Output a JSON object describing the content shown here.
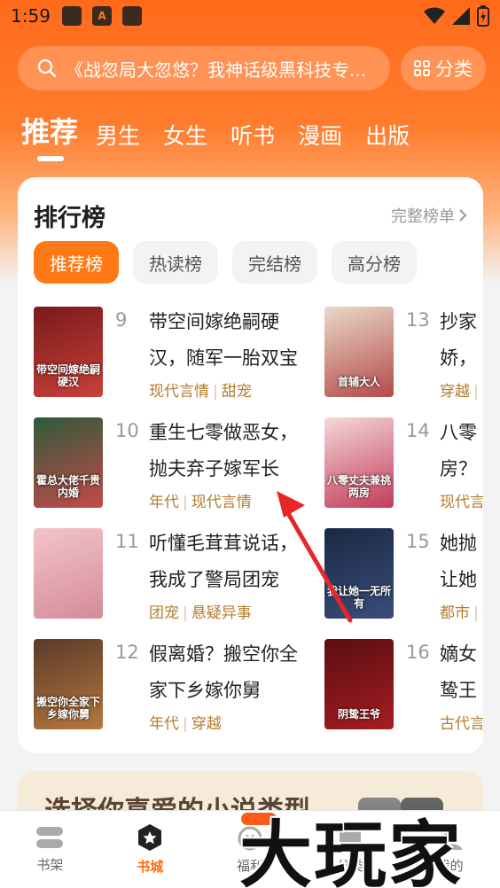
{
  "status": {
    "time": "1:59",
    "app_icon_letter": "A"
  },
  "search": {
    "placeholder": "《战忽局大忽悠？我神话级黑科技专...",
    "category_label": "分类"
  },
  "top_tabs": [
    "推荐",
    "男生",
    "女生",
    "听书",
    "漫画",
    "出版"
  ],
  "ranking": {
    "title": "排行榜",
    "more": "完整榜单",
    "chips": [
      "推荐榜",
      "热读榜",
      "完结榜",
      "高分榜"
    ],
    "books_left": [
      {
        "rank": "9",
        "title": "带空间嫁绝嗣硬汉，随军一胎双宝",
        "tags": [
          "现代言情",
          "甜宠"
        ],
        "cover_text": "带空间嫁绝嗣硬汉",
        "cover_colors": [
          "#7a1a1a",
          "#c9403a"
        ]
      },
      {
        "rank": "10",
        "title": "重生七零做恶女，抛夫弃子嫁军长",
        "tags": [
          "年代",
          "现代言情"
        ],
        "cover_text": "霍总大佬千贵内婚",
        "cover_colors": [
          "#2f5a3a",
          "#c44a4a"
        ]
      },
      {
        "rank": "11",
        "title": "听懂毛茸茸说话，我成了警局团宠",
        "tags": [
          "团宠",
          "悬疑异事"
        ],
        "cover_text": "",
        "cover_colors": [
          "#f2c4c8",
          "#d58b9a"
        ]
      },
      {
        "rank": "12",
        "title": "假离婚？搬空你全家下乡嫁你舅",
        "tags": [
          "年代",
          "穿越"
        ],
        "cover_text": "搬空你全家下乡嫁你舅",
        "cover_colors": [
          "#5a3a2a",
          "#b5783e"
        ]
      }
    ],
    "books_right": [
      {
        "rank": "13",
        "title": "抄家",
        "line2": "娇，",
        "tags": [
          "穿越"
        ],
        "cover_text": "首辅大人",
        "cover_colors": [
          "#e9d9c8",
          "#b44a4a"
        ]
      },
      {
        "rank": "14",
        "title": "八零",
        "line2": "房？",
        "tags": [
          "现代言"
        ],
        "cover_text": "八零丈夫兼祧两房",
        "cover_colors": [
          "#f4d8d8",
          "#c33b5a"
        ]
      },
      {
        "rank": "15",
        "title": "她抛",
        "line2": "让她",
        "tags": [
          "都市"
        ],
        "cover_text": "我让她一无所有",
        "cover_colors": [
          "#1a2a44",
          "#3a4c7a"
        ]
      },
      {
        "rank": "16",
        "title": "嫡女",
        "line2": "鸷王",
        "tags": [
          "古代言"
        ],
        "cover_text": "阴鸷王爷",
        "cover_colors": [
          "#5a0e12",
          "#a41d22"
        ]
      }
    ]
  },
  "preference": {
    "title": "选择你喜爱的小说类型"
  },
  "bottom_nav": [
    "书架",
    "书城",
    "福利",
    "分类",
    "我的"
  ],
  "watermark": "大玩家",
  "colors": {
    "accent": "#ff7a17",
    "tag": "#b37c2e"
  }
}
